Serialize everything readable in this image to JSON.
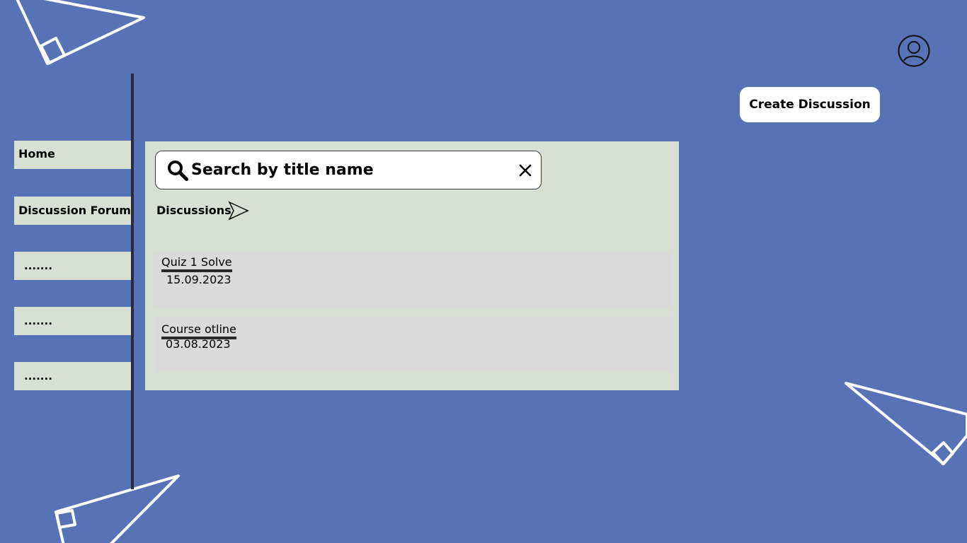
{
  "header": {
    "create_label": "Create Discussion"
  },
  "sidebar": {
    "items": [
      {
        "label": "Home"
      },
      {
        "label": "Discussion Forum"
      },
      {
        "label": "......."
      },
      {
        "label": "......."
      },
      {
        "label": "......."
      }
    ]
  },
  "search": {
    "placeholder": "Search by title name",
    "value": ""
  },
  "discussions": {
    "title": "Discussions",
    "items": [
      {
        "title": "Quiz 1 Solve",
        "date": "15.09.2023"
      },
      {
        "title": "Course otline",
        "date": "03.08.2023"
      }
    ]
  },
  "colors": {
    "background": "#5872b6",
    "panel": "#d8e0d3",
    "card": "#dadada",
    "button": "#ffffff",
    "divider": "#272b3a"
  },
  "icons": {
    "profile": "user-circle-icon",
    "search": "magnifier-icon",
    "clear": "x-icon",
    "arrow": "send-arrow-icon"
  }
}
